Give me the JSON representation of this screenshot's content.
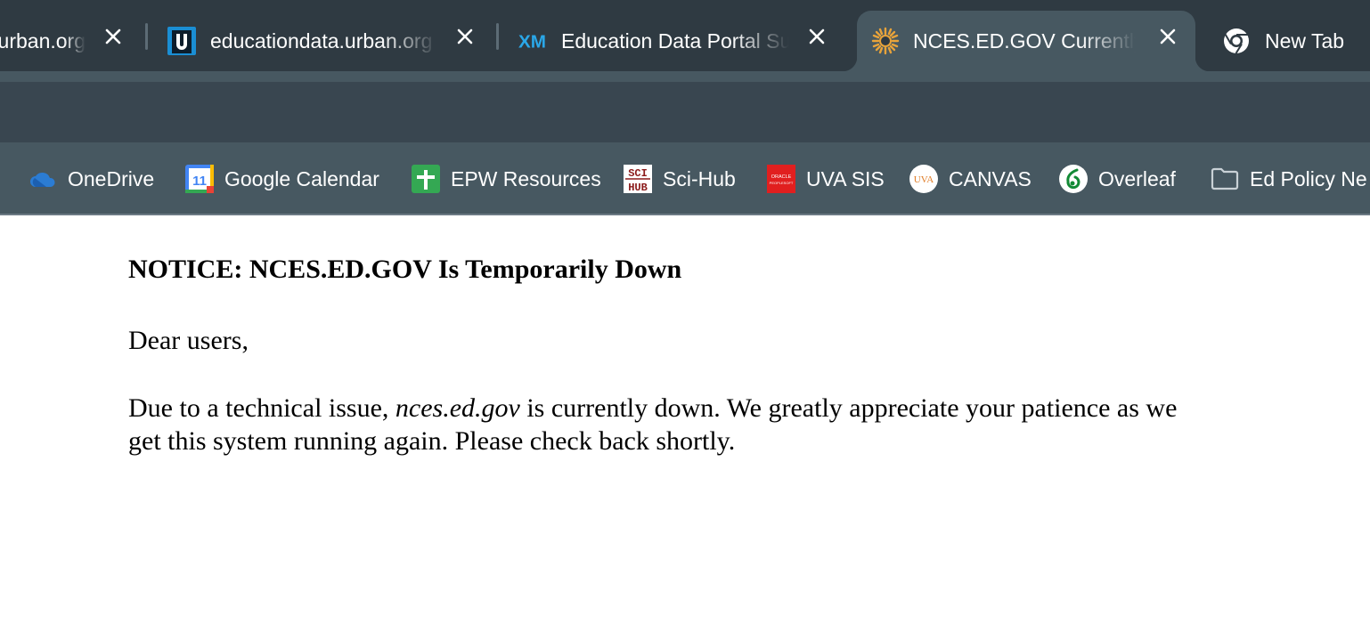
{
  "tabs": [
    {
      "title": "urban.org",
      "icon": "urban-icon"
    },
    {
      "title": "educationdata.urban.org",
      "icon": "urban-u-icon"
    },
    {
      "title": "Education Data Portal Su",
      "icon": "xm-icon"
    },
    {
      "title": "NCES.ED.GOV Currently",
      "icon": "nces-sun-icon",
      "active": true
    }
  ],
  "new_tab": {
    "label": "New Tab",
    "icon": "chrome-icon"
  },
  "bookmarks": [
    {
      "label": "OneDrive",
      "icon": "onedrive-icon"
    },
    {
      "label": "Google Calendar",
      "icon": "google-calendar-icon",
      "badge": "11"
    },
    {
      "label": "EPW Resources",
      "icon": "google-sheets-icon"
    },
    {
      "label": "Sci-Hub",
      "icon": "scihub-icon",
      "badge_top": "SCI",
      "badge_bottom": "HUB"
    },
    {
      "label": "UVA SIS",
      "icon": "oracle-peoplesoft-icon",
      "badge_top": "ORACLE",
      "badge_bottom": "PEOPLESOFT"
    },
    {
      "label": "CANVAS",
      "icon": "uva-icon",
      "badge": "UVA"
    },
    {
      "label": "Overleaf",
      "icon": "overleaf-icon"
    },
    {
      "label": "Ed Policy Ne",
      "icon": "folder-icon"
    }
  ],
  "page": {
    "title": "NOTICE: NCES.ED.GOV Is Temporarily Down",
    "greeting": "Dear users,",
    "message_before": "Due to a technical issue, ",
    "message_site": "nces.ed.gov",
    "message_after": " is currently down. We greatly appreciate your patience as we get this system running again. Please check back shortly."
  },
  "colors": {
    "tabstrip": "#2f3a42",
    "active_tab": "#475861",
    "toolbar": "#394650",
    "bookmarks_bar": "#475861"
  }
}
